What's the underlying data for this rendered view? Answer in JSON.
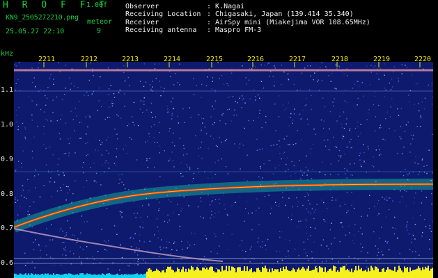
{
  "header": {
    "app_title": "H R O F F T",
    "version": "1.00f",
    "filename": "KN9_2505272210.png",
    "datetime": "25.05.27 22:10",
    "meteor_label": "meteor",
    "meteor_count": "9"
  },
  "station_info": [
    {
      "key": "Observer",
      "value": ": K.Nagai"
    },
    {
      "key": "Receiving Location",
      "value": ": Chigasaki, Japan (139.414 35.340)"
    },
    {
      "key": "Receiver",
      "value": ": AirSpy mini (Miakejima VOR 108.65MHz)"
    },
    {
      "key": "Receiving antenna",
      "value": ": Maspro FM-3"
    }
  ],
  "axes": {
    "unit": "kHz",
    "x_ticks": [
      "2211",
      "2212",
      "2213",
      "2214",
      "2215",
      "2216",
      "2217",
      "2218",
      "2219",
      "2220"
    ],
    "y_ticks": [
      "1.1",
      "1.0",
      "0.9",
      "0.8",
      "0.7",
      "0.6"
    ]
  },
  "colors": {
    "background": "#0d1a6e",
    "accent_green": "#19d23a",
    "tick_yellow": "#f2e600",
    "trace_red": "#ff3a1a",
    "noise_bar_cyan": "#12d2f0",
    "noise_bar_yellow": "#f5f01e"
  }
}
